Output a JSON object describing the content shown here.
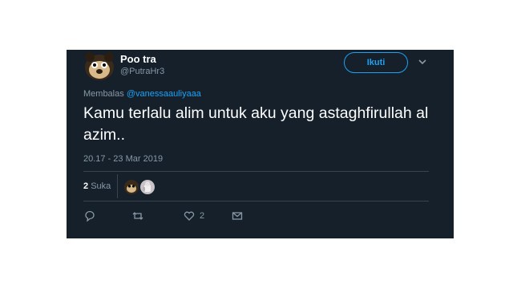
{
  "tweet": {
    "display_name": "Poo tra",
    "handle": "@PutraHr3",
    "follow_label": "Ikuti",
    "reply_prefix": "Membalas",
    "reply_to": "@vanessaauliyaaa",
    "text": "Kamu terlalu alim untuk aku yang astaghfirullah al azim..",
    "timestamp": "20.17 - 23 Mar 2019",
    "likes_count": "2",
    "likes_label": "Suka",
    "like_action_count": "2"
  },
  "colors": {
    "background": "#15202b",
    "accent": "#1da1f2",
    "muted": "#8899a6",
    "divider": "#38444d"
  },
  "icons": [
    "avatar",
    "chevron-down-icon",
    "reply-icon",
    "retweet-icon",
    "heart-icon",
    "message-icon"
  ]
}
